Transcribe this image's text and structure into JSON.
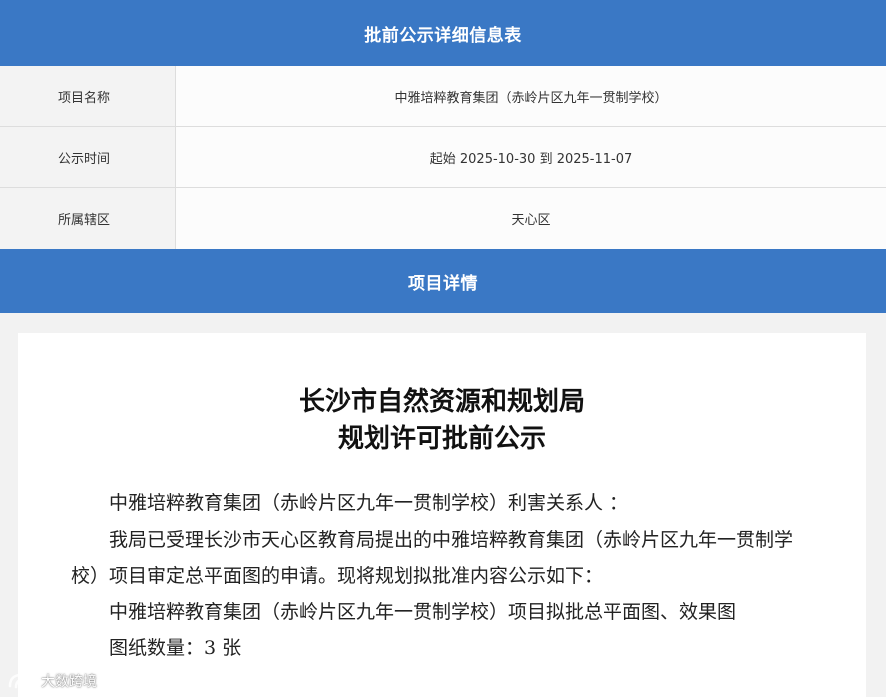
{
  "header": {
    "title": "批前公示详细信息表"
  },
  "info_rows": [
    {
      "label": "项目名称",
      "value": "中雅培粹教育集团（赤岭片区九年一贯制学校）"
    },
    {
      "label": "公示时间",
      "value": "起始 2025-10-30 到 2025-11-07"
    },
    {
      "label": "所属辖区",
      "value": "天心区"
    }
  ],
  "detail": {
    "section_title": "项目详情",
    "doc_title_line1": "长沙市自然资源和规划局",
    "doc_title_line2": "规划许可批前公示",
    "addressee": "中雅培粹教育集团（赤岭片区九年一贯制学校）利害关系人 ：",
    "paragraph1": "我局已受理长沙市天心区教育局提出的中雅培粹教育集团（赤岭片区九年一贯制学校）项目审定总平面图的申请。现将规划拟批准内容公示如下：",
    "paragraph2": "中雅培粹教育集团（赤岭片区九年一贯制学校）项目拟批总平面图、效果图",
    "paragraph3": "图纸数量：3 张"
  },
  "watermark": {
    "text": "大数跨境",
    "icon": "dashuju-logo-icon"
  },
  "colors": {
    "header_bar": "#3a78c5",
    "label_bg": "#f3f3f3",
    "detail_bg": "#f2f2f2"
  }
}
